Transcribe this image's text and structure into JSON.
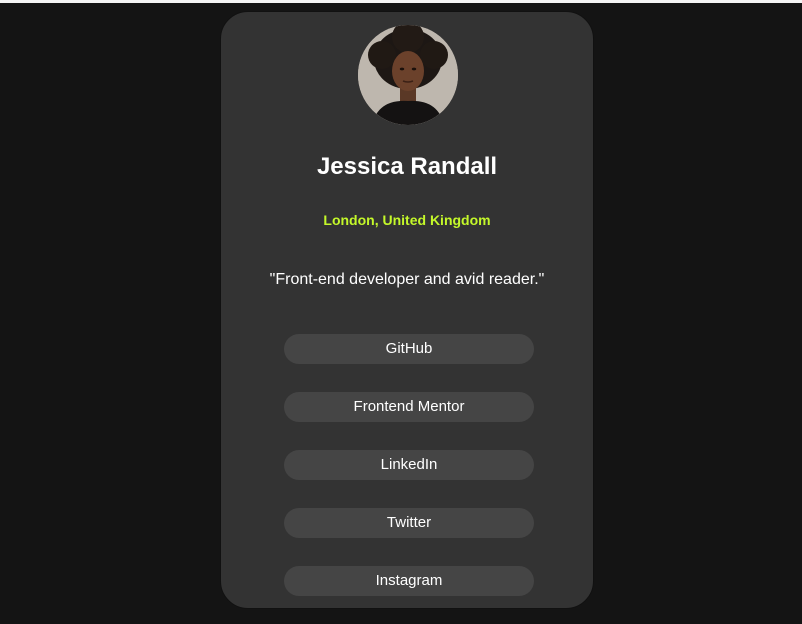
{
  "profile": {
    "name": "Jessica Randall",
    "location": "London, United Kingdom",
    "bio": "\"Front-end developer and avid reader.\""
  },
  "links": [
    {
      "label": "GitHub"
    },
    {
      "label": "Frontend Mentor"
    },
    {
      "label": "LinkedIn"
    },
    {
      "label": "Twitter"
    },
    {
      "label": "Instagram"
    }
  ],
  "colors": {
    "page_background": "#141414",
    "card_background": "#333333",
    "accent": "#c4f82a",
    "button_background": "#454545",
    "text": "#ffffff"
  }
}
